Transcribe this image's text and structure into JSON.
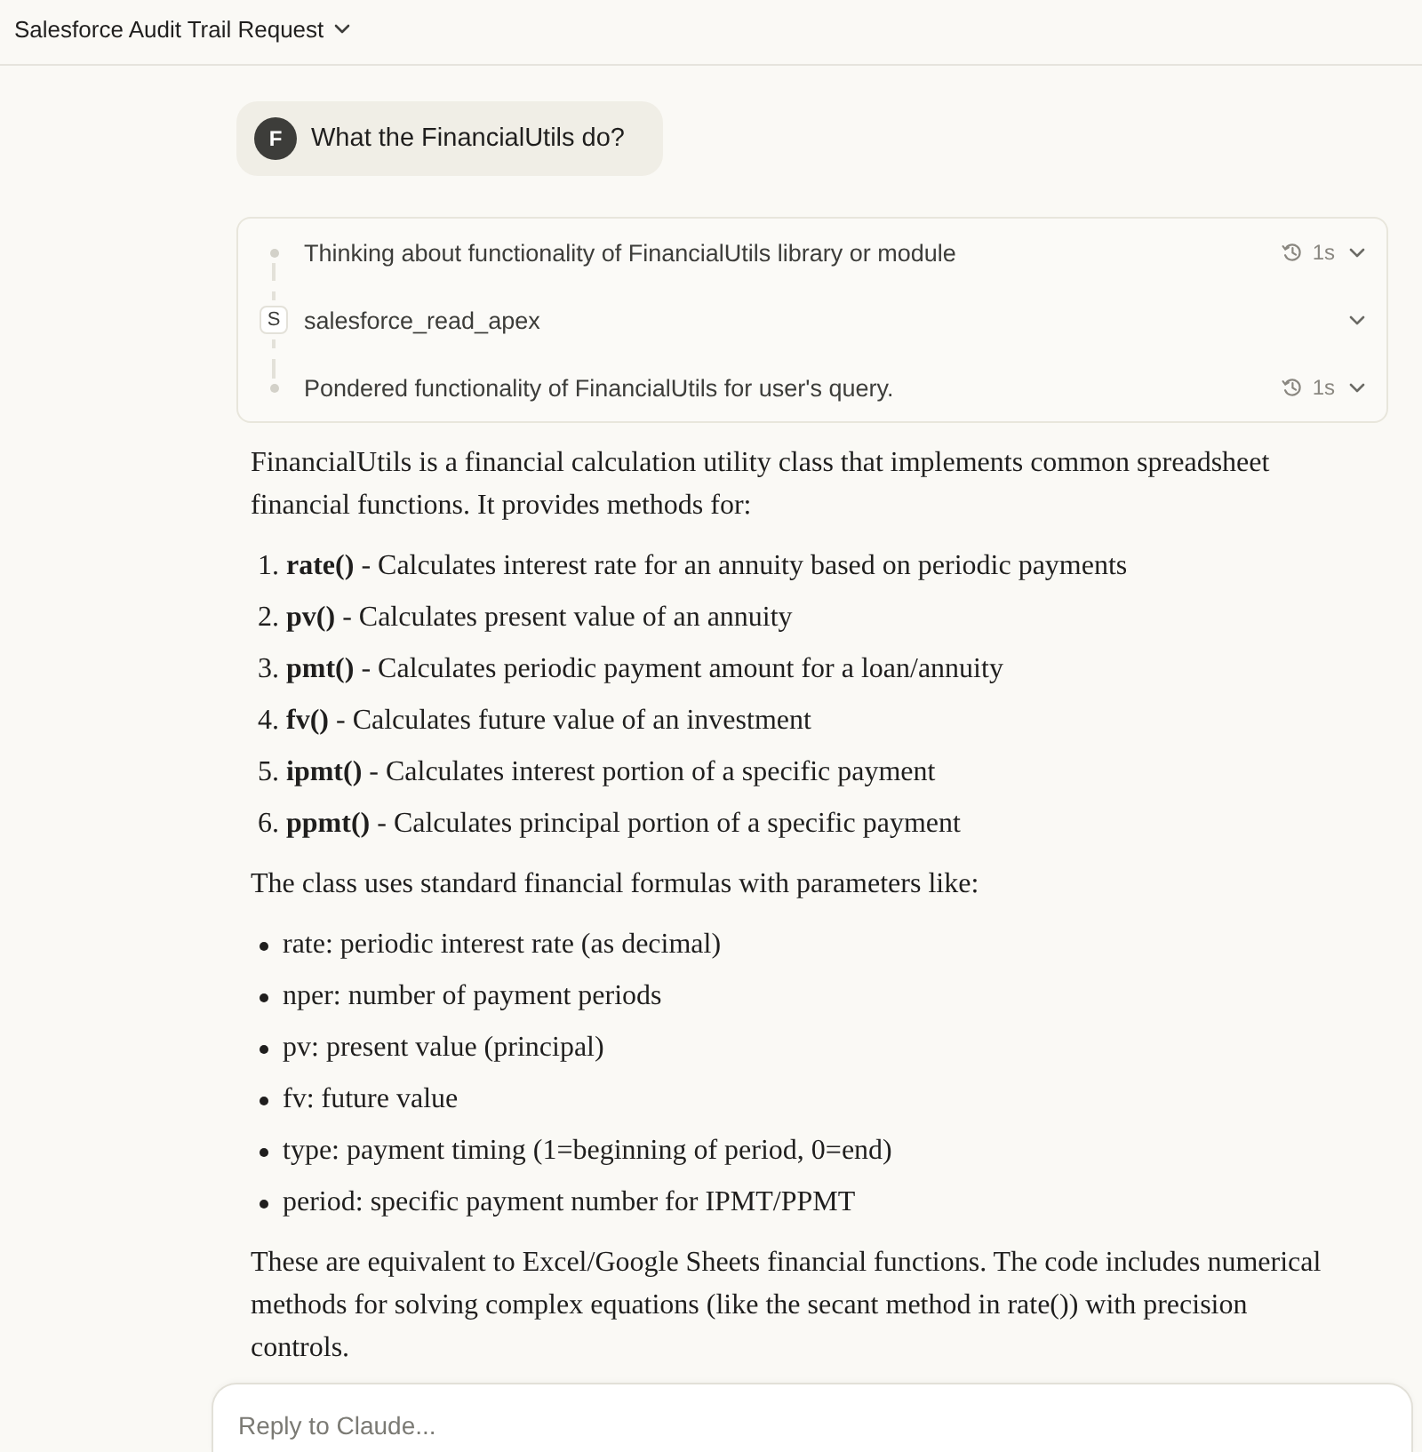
{
  "header": {
    "title": "Salesforce Audit Trail Request"
  },
  "user_message": {
    "avatar_initial": "F",
    "text": "What the FinancialUtils do?"
  },
  "activity": {
    "steps": [
      {
        "kind": "thought",
        "text": "Thinking about functionality of FinancialUtils library or module",
        "duration": "1s",
        "expanded": false
      },
      {
        "kind": "tool",
        "tile_letter": "S",
        "text": "salesforce_read_apex",
        "expanded": false
      },
      {
        "kind": "thought",
        "text": "Pondered functionality of FinancialUtils for user's query.",
        "duration": "1s",
        "expanded": false
      }
    ]
  },
  "response": {
    "blocks": [
      {
        "kind": "paragraph",
        "text": "FinancialUtils is a financial calculation utility class that implements common spreadsheet financial functions. It provides methods for:"
      },
      {
        "kind": "numbered_list",
        "items": [
          {
            "number": "1.",
            "text": "**rate()** - Calculates interest rate for an annuity based on periodic payments"
          },
          {
            "number": "2.",
            "text": "**pv()** - Calculates present value of an annuity"
          },
          {
            "number": "3.",
            "text": "**pmt()** - Calculates periodic payment amount for a loan/annuity"
          },
          {
            "number": "4.",
            "text": "**fv()** - Calculates future value of an investment"
          },
          {
            "number": "5.",
            "text": "**ipmt()** - Calculates interest portion of a specific payment"
          },
          {
            "number": "6.",
            "text": "**ppmt()** - Calculates principal portion of a specific payment"
          }
        ]
      },
      {
        "kind": "paragraph",
        "text": "The class uses standard financial formulas with parameters like:"
      },
      {
        "kind": "bullet_list",
        "items": [
          "rate: periodic interest rate (as decimal)",
          "nper: number of payment periods",
          "pv: present value (principal)",
          "fv: future value",
          "type: payment timing (1=beginning of period, 0=end)",
          "period: specific payment number for IPMT/PPMT"
        ]
      },
      {
        "kind": "paragraph",
        "text": "These are equivalent to Excel/Google Sheets financial functions. The code includes numerical methods for solving complex equations (like the secant method in rate()) with precision controls."
      }
    ]
  },
  "composer": {
    "placeholder": "Reply to Claude..."
  }
}
